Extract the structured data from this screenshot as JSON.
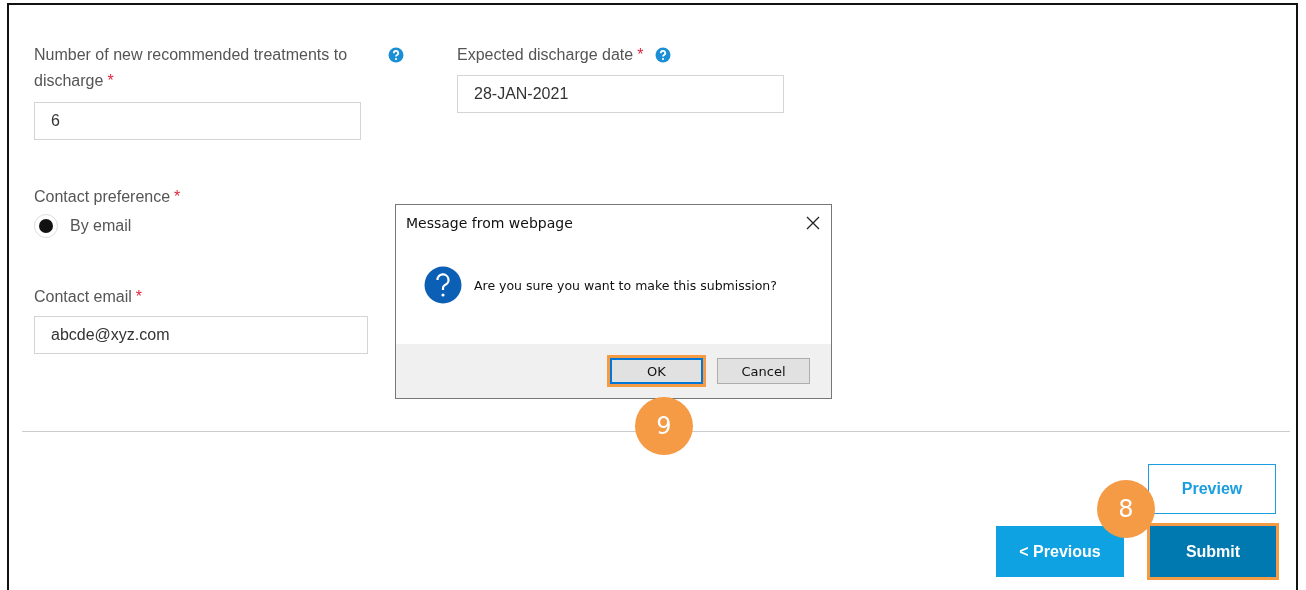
{
  "form": {
    "fields": [
      {
        "label": "Number of new recommended treatments to discharge",
        "required_mark": "*",
        "help": true,
        "value": "6"
      },
      {
        "label": "Expected discharge date",
        "required_mark": "*",
        "help": true,
        "value": "28-JAN-2021"
      }
    ],
    "contact_preference": {
      "label": "Contact preference",
      "required_mark": "*",
      "options": [
        {
          "label": "By email",
          "selected": true
        }
      ]
    },
    "contact_email": {
      "label": "Contact email",
      "required_mark": "*",
      "value": "abcde@xyz.com"
    }
  },
  "buttons": [
    {
      "label": "Preview",
      "kind": "outline",
      "highlighted": false
    },
    {
      "label": "< Previous",
      "kind": "secondary",
      "highlighted": false
    },
    {
      "label": "Submit",
      "kind": "primary",
      "highlighted": true
    }
  ],
  "dialog": {
    "title": "Message from webpage",
    "message": "Are you sure you want to make this submission?",
    "buttons": [
      {
        "label": "OK",
        "highlighted": true
      },
      {
        "label": "Cancel",
        "highlighted": false
      }
    ]
  },
  "dialog_step_marker": "9",
  "submit_step_marker": "8"
}
